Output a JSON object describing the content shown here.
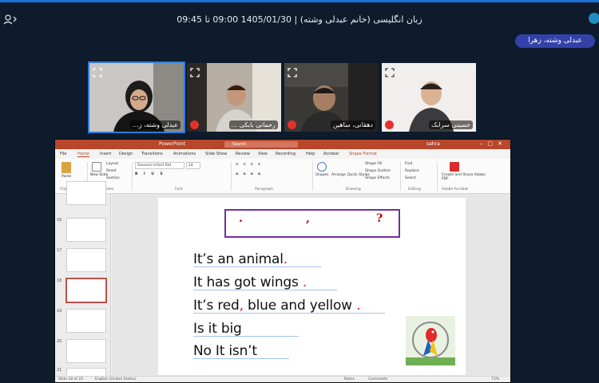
{
  "session": {
    "title": "زبان انگلیسی (خانم عبدلی وشته) | 1405/01/30  09:00 تا 09:45",
    "presenter_chip": "عبدلی وشته، زهرا"
  },
  "videos": [
    {
      "name": "عبدلی وشته، ز...",
      "mic_muted": false,
      "active": true
    },
    {
      "name": "رحمانی بابکی ...",
      "mic_muted": true,
      "active": false
    },
    {
      "name": "دهقانی، ساهین",
      "mic_muted": true,
      "active": false
    },
    {
      "name": "حسینی سرابک",
      "mic_muted": true,
      "active": false
    }
  ],
  "ppt": {
    "app_name": "PowerPoint",
    "search_placeholder": "Search",
    "user": "sahra",
    "tabs": [
      "File",
      "Home",
      "Insert",
      "Design",
      "Transitions",
      "Animations",
      "Slide Show",
      "Review",
      "View",
      "Recording",
      "Help",
      "Acrobat",
      "Shape Format"
    ],
    "ribbon": {
      "paste": "Paste",
      "new_slide": "New Slide",
      "layout": "Layout",
      "reset": "Reset",
      "section": "Section",
      "font_name": "Sassoon Infant Std",
      "font_size": "24",
      "shapes": "Shapes",
      "arrange": "Arrange",
      "quick_styles": "Quick Styles",
      "shape_fill": "Shape Fill",
      "shape_outline": "Shape Outline",
      "shape_effects": "Shape Effects",
      "find": "Find",
      "replace": "Replace",
      "select": "Select",
      "create_share": "Create and Share Adobe PDF",
      "groups": {
        "clipboard": "Clipboard",
        "slides": "Slides",
        "font": "Font",
        "paragraph": "Paragraph",
        "drawing": "Drawing",
        "editing": "Editing",
        "adobe": "Adobe Acrobat"
      }
    },
    "thumb_numbers": [
      "16",
      "17",
      "18",
      "19",
      "20",
      "21"
    ],
    "slide": {
      "qbox": {
        "dot": ".",
        "comma": ",",
        "question": "?"
      },
      "lines": [
        {
          "text": "It’s an animal",
          "punct": "."
        },
        {
          "text": "It has got wings",
          "punct": "."
        },
        {
          "text": "It’s red",
          "mid": ",",
          "rest": " blue and yellow",
          "punct": "."
        },
        {
          "text": "Is it big",
          "punct": ""
        },
        {
          "text": "No It isn’t",
          "punct": ""
        }
      ]
    },
    "status": {
      "slide_of": "Slide 18 of 22",
      "language": "English (United States)",
      "notes": "Notes",
      "comments": "Comments",
      "zoom": "73%"
    },
    "colors": {
      "accent": "#b7472a",
      "purple_box": "#7030a0",
      "red_punct": "#e31b23"
    }
  }
}
